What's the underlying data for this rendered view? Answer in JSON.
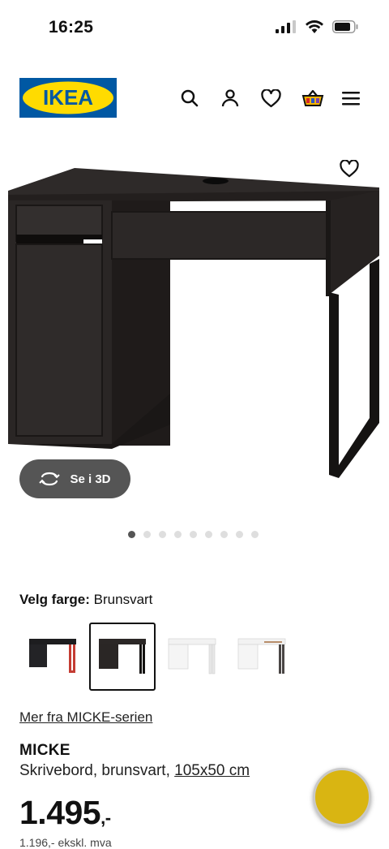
{
  "status_bar": {
    "time": "16:25"
  },
  "header": {
    "logo_text": "IKEA",
    "icons": [
      "search-icon",
      "user-icon",
      "heart-icon",
      "basket-icon",
      "menu-icon"
    ]
  },
  "gallery": {
    "view_3d_label": "Se i 3D",
    "dot_count": 9,
    "active_dot": 1
  },
  "color": {
    "label": "Velg farge:",
    "selected_value": "Brunsvart",
    "swatches": [
      "black-red",
      "black-brown",
      "white",
      "white-oak"
    ],
    "selected_index": 1
  },
  "series_link": "Mer fra MICKE-serien",
  "product": {
    "name": "MICKE",
    "description": "Skrivebord, brunsvart,",
    "dimensions": "105x50 cm",
    "price": "1.495",
    "price_suffix": ",-",
    "price_sub": "1.196,- ekskl. mva"
  },
  "colors": {
    "ikea_blue": "#0058a3",
    "ikea_yellow": "#ffdb00",
    "chat_yellow": "#d9b512"
  }
}
